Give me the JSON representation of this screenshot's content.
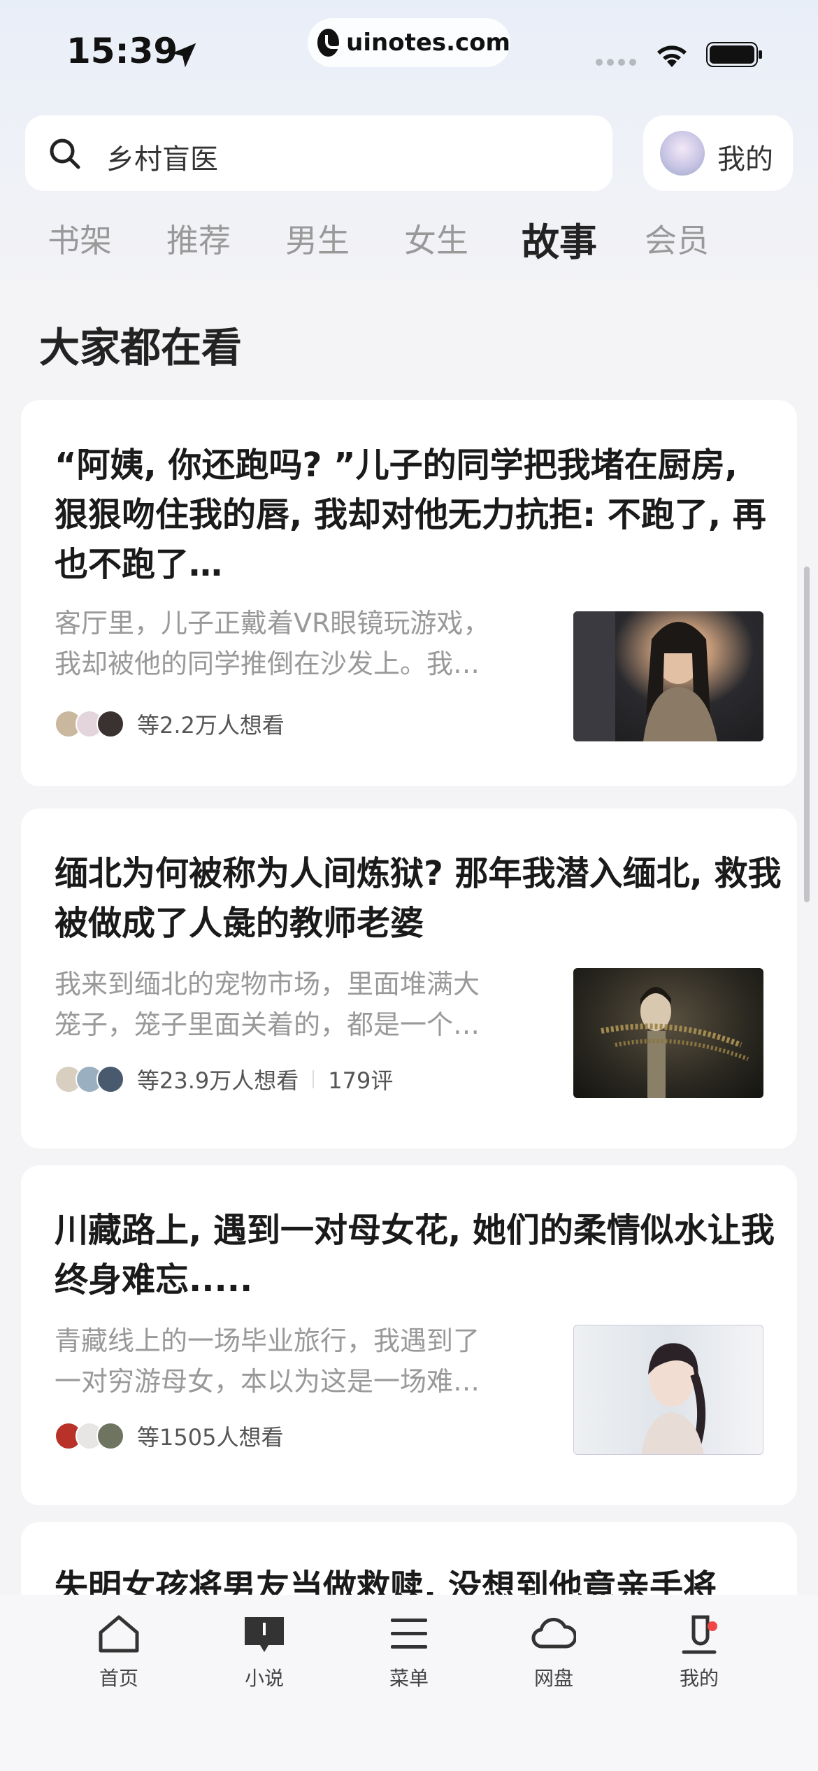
{
  "status_bar": {
    "time": "15:39",
    "url": "uinotes.com"
  },
  "search": {
    "text": "乡村盲医"
  },
  "mine_button": {
    "label": "我的"
  },
  "tabs": [
    {
      "label": "书架",
      "active": false
    },
    {
      "label": "推荐",
      "active": false
    },
    {
      "label": "男生",
      "active": false
    },
    {
      "label": "女生",
      "active": false
    },
    {
      "label": "故事",
      "active": true
    },
    {
      "label": "会员",
      "active": false
    }
  ],
  "section": {
    "title": "大家都在看"
  },
  "cards": [
    {
      "title": "“阿姨, 你还跑吗? ”儿子的同学把我堵在厨房, 狠狠吻住我的唇, 我却对他无力抗拒: 不跑了, 再也不跑了…",
      "desc_line1": "客厅里，儿子正戴着VR眼镜玩游戏，",
      "desc_line2": "我却被他的同学推倒在沙发上。我…",
      "readers": "等2.2万人想看",
      "comments": ""
    },
    {
      "title": "缅北为何被称为人间炼狱? 那年我潜入缅北, 救我被做成了人彘的教师老婆",
      "desc_line1": "我来到缅北的宠物市场，里面堆满大",
      "desc_line2": "笼子，笼子里面关着的，都是一个…",
      "readers": "等23.9万人想看",
      "comments": "179评"
    },
    {
      "title": "川藏路上, 遇到一对母女花, 她们的柔情似水让我终身难忘.....",
      "desc_line1": "青藏线上的一场毕业旅行，我遇到了",
      "desc_line2": "一对穷游母女，本以为这是一场难…",
      "readers": "等1505人想看",
      "comments": ""
    },
    {
      "title": "失明女孩将男友当做救赎, 没想到他竟亲手将",
      "desc_line1": "",
      "desc_line2": "",
      "readers": "",
      "comments": ""
    }
  ],
  "bottom_nav": [
    {
      "label": "首页",
      "icon": "home-icon"
    },
    {
      "label": "小说",
      "icon": "book-icon"
    },
    {
      "label": "菜单",
      "icon": "menu-icon"
    },
    {
      "label": "网盘",
      "icon": "cloud-icon"
    },
    {
      "label": "我的",
      "icon": "profile-icon"
    }
  ],
  "colors": {
    "accent_dot": "#f04646",
    "active_tab": "#222222",
    "inactive_tab": "#999999"
  }
}
